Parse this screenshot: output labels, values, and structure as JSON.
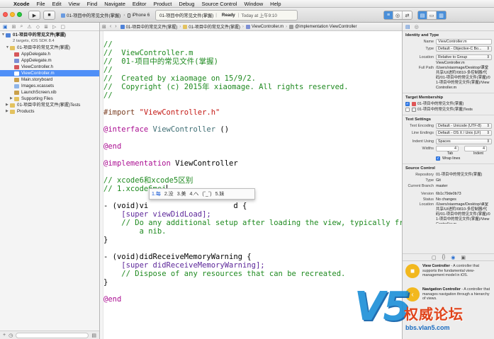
{
  "menubar": {
    "app": "Xcode",
    "items": [
      "File",
      "Edit",
      "View",
      "Find",
      "Navigate",
      "Editor",
      "Product",
      "Debug",
      "Source Control",
      "Window",
      "Help"
    ]
  },
  "toolbar": {
    "scheme_target": "01-项目中的常见文件(掌握)",
    "scheme_device": "iPhone 6",
    "activity_project": "01-项目中的常见文件(掌握)",
    "activity_status": "Ready",
    "activity_time": "Today at 上午9:10"
  },
  "navigator": {
    "project_name": "01-项目中的常见文件(掌握)",
    "project_sub": "2 targets, iOS SDK 8.4",
    "items": [
      {
        "label": "01-项目中的常见文件(掌握)",
        "kind": "folder"
      },
      {
        "label": "AppDelegate.h",
        "kind": "h"
      },
      {
        "label": "AppDelegate.m",
        "kind": "m"
      },
      {
        "label": "ViewController.h",
        "kind": "h"
      },
      {
        "label": "ViewController.m",
        "kind": "m",
        "selected": true
      },
      {
        "label": "Main.storyboard",
        "kind": "sb"
      },
      {
        "label": "Images.xcassets",
        "kind": "asset"
      },
      {
        "label": "LaunchScreen.xib",
        "kind": "xib"
      },
      {
        "label": "Supporting Files",
        "kind": "folder"
      },
      {
        "label": "01-项目中的常见文件(掌握)Tests",
        "kind": "folder"
      },
      {
        "label": "Products",
        "kind": "folder"
      }
    ]
  },
  "jumpbar": {
    "crumbs": [
      "01-项目中的常见文件(掌握)",
      "01-项目中的常见文件(掌握)",
      "ViewController.m",
      "@implementation ViewController"
    ]
  },
  "code": {
    "l1": "//",
    "l2": "//  ViewController.m",
    "l3": "//  01-项目中的常见文件(掌握)",
    "l4": "//",
    "l5": "//  Created by xiaomage on 15/9/2.",
    "l6": "//  Copyright (c) 2015年 xiaomage. All rights reserved.",
    "l7": "//",
    "import_kw": "#import",
    "import_str": "\"ViewController.h\"",
    "interface_kw": "@interface",
    "interface_name": "ViewController",
    "interface_paren": "()",
    "end1": "@end",
    "impl_kw": "@implementation",
    "impl_name": "ViewController",
    "c1": "// xcode6和xcode5区别",
    "c2_prefix": "// 1.xcode6",
    "c2_marked": "mei",
    "m1_prefix": "- (void)vi",
    "m1_tail": "d {",
    "super1": "[super viewDidLoad];",
    "c3": "// Do any additional setup after loading the view, typically from",
    "c3b": "a nib.",
    "close1": "}",
    "m2": "- (void)didReceiveMemoryWarning {",
    "super2": "[super didReceiveMemoryWarning];",
    "c4": "// Dispose of any resources that can be recreated.",
    "close2": "}",
    "end2": "@end"
  },
  "ime": {
    "candidates": [
      "1.每",
      "2.没",
      "3.美",
      "4.へ",
      "(ˇ_ˇ)",
      "5.妹"
    ]
  },
  "inspector": {
    "identity_title": "Identity and Type",
    "name_label": "Name",
    "name_value": "ViewController.m",
    "type_label": "Type",
    "type_value": "Default - Objective-C Bo...",
    "location_label": "Location",
    "location_value": "Relative to Group",
    "location_file": "ViewController.m",
    "fullpath_label": "Full Path",
    "fullpath_value": "/Users/xiaomage/Desktop/课堂共享/UI进阶/0810-多控制器/代码/01-项目中的常见文件(掌握)/01-项目中的常见文件(掌握)/ViewController.m",
    "membership_title": "Target Membership",
    "member1": "01-项目中的常见文件(掌握)",
    "member2": "01-项目中的常见文件(掌握)Tests",
    "textsettings_title": "Text Settings",
    "encoding_label": "Text Encoding",
    "encoding_value": "Default - Unicode (UTF-8)",
    "endings_label": "Line Endings",
    "endings_value": "Default - OS X / Unix (LF)",
    "indent_label": "Indent Using",
    "indent_value": "Spaces",
    "widths_label": "Widths",
    "tab_value": "4",
    "indent_width_value": "4",
    "tab_caption": "Tab",
    "indent_caption": "Indent",
    "wrap_label": "Wrap lines",
    "sc_title": "Source Control",
    "repo_label": "Repository",
    "repo_value": "01-项目中的常见文件(掌握)",
    "sctype_label": "Type",
    "sctype_value": "Git",
    "branch_label": "Current Branch",
    "branch_value": "master",
    "version_label": "Version",
    "version_value": "6b1c79de0b73",
    "status_label": "Status",
    "status_value": "No changes",
    "sclocation_label": "Location",
    "sclocation_value": "/Users/xiaomage/Desktop/课堂共享/UI进阶/0810-多控制器/代码/01-项目中的常见文件(掌握)/01-项目中的常见文件(掌握)/ViewController.m"
  },
  "library": {
    "vc_title": "View Controller",
    "vc_desc": " - A controller that supports the fundamental view-management model in iOS.",
    "nav_title": "Navigation Controller",
    "nav_desc": " - A controller that manages navigation through a hierarchy of views."
  },
  "watermark": {
    "mark": "V5",
    "title": "权威论坛",
    "url": "bbs.vlan5.com"
  },
  "colors": {
    "selection": "#4f8ff7",
    "comment": "#1f8a20",
    "keyword": "#aa0d91",
    "string": "#c41a16",
    "preprocessor": "#7a3e22"
  }
}
